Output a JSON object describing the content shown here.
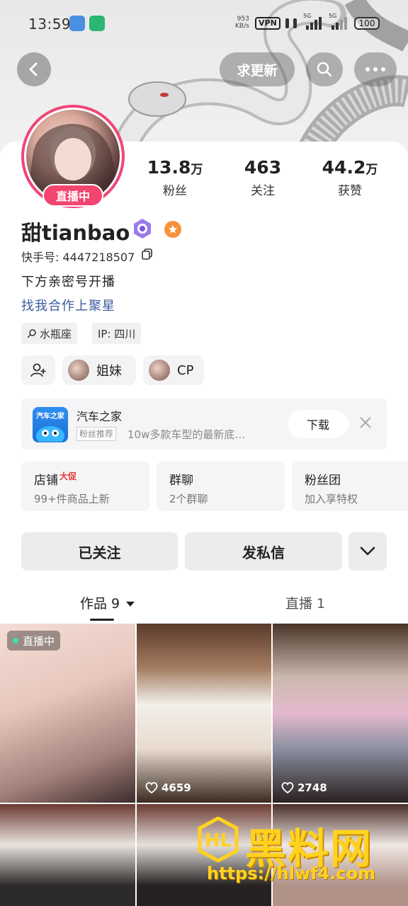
{
  "status_bar": {
    "time": "13:59",
    "net_speed_top": "953",
    "net_speed_bottom": "KB/s",
    "vpn": "VPN",
    "sig1": "5G",
    "sig2": "5G",
    "battery": "100"
  },
  "header": {
    "request_update_label": "求更新"
  },
  "profile": {
    "live_badge": "直播中",
    "username": "甜tianbao",
    "kwai_id": "快手号: 4447218507",
    "bio_line1": "下方亲密号开播",
    "bio_line2": "找我合作上聚星",
    "stats": [
      {
        "num": "13.8",
        "unit": "万",
        "label": "粉丝"
      },
      {
        "num": "463",
        "unit": "",
        "label": "关注"
      },
      {
        "num": "44.2",
        "unit": "万",
        "label": "获赞"
      }
    ],
    "tags": [
      "水瓶座",
      "IP: 四川"
    ],
    "relations": [
      "姐妹",
      "CP"
    ]
  },
  "ad": {
    "logo_text": "汽车之家",
    "title": "汽车之家",
    "tag": "粉丝推荐",
    "desc": "10w多款车型的最新底…",
    "download_label": "下载"
  },
  "features": [
    {
      "title": "店铺",
      "promo": "大促",
      "sub": "99+件商品上新"
    },
    {
      "title": "群聊",
      "promo": "",
      "sub": "2个群聊"
    },
    {
      "title": "粉丝团",
      "promo": "",
      "sub": "加入享特权"
    }
  ],
  "actions": {
    "followed_label": "已关注",
    "message_label": "发私信"
  },
  "tabs": {
    "works_label": "作品 9",
    "live_label": "直播 1"
  },
  "grid": {
    "live_label": "直播中",
    "like_counts": [
      "4659",
      "2748"
    ]
  },
  "watermark": {
    "title": "黑料网",
    "url": "https://hlwf4.com"
  },
  "colors": {
    "live_pink": "#f2456f",
    "link_blue": "#3b5b9e",
    "watermark_yellow": "#ffd21f"
  }
}
